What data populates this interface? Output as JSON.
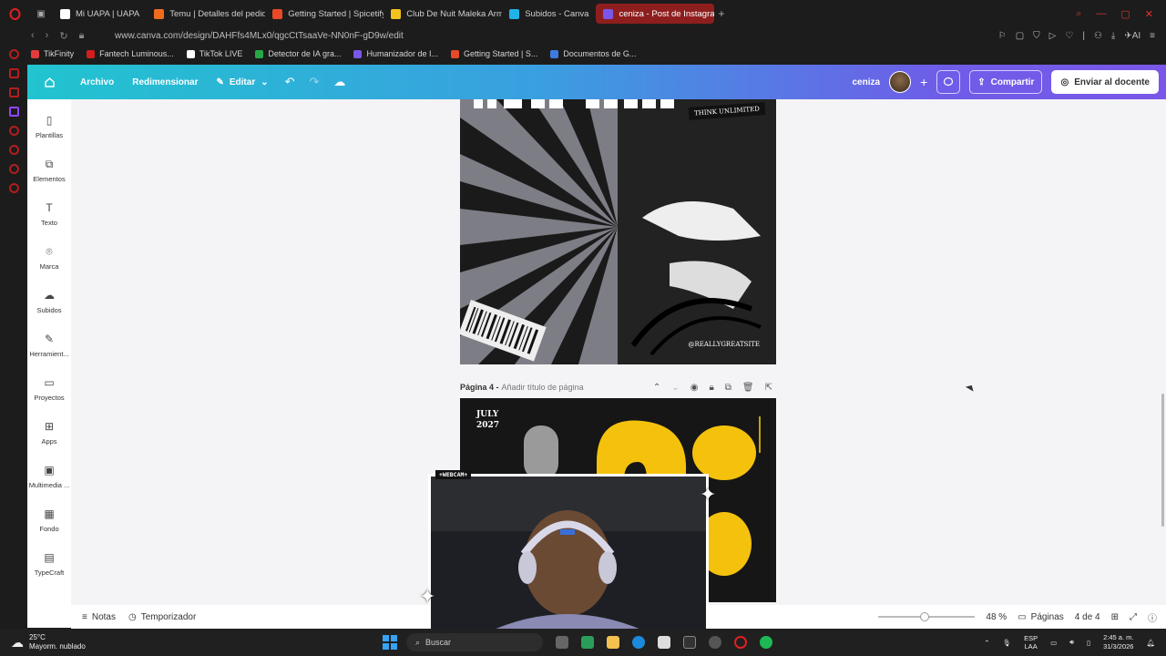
{
  "browser": {
    "tabs": [
      {
        "label": "Mi UAPA | UAPA",
        "color": "#ffffff"
      },
      {
        "label": "Temu | Detalles del pedido",
        "color": "#f26b1d"
      },
      {
        "label": "Getting Started | Spicetify",
        "color": "#e84a27"
      },
      {
        "label": "Club De Nuit Maleka Arme",
        "color": "#f3c320"
      },
      {
        "label": "Subidos - Canva",
        "color": "#20b3e8"
      },
      {
        "label": "ceniza - Post de Instagram",
        "color": "#7a57e8",
        "active": true
      }
    ],
    "url": "www.canva.com/design/DAHFfs4MLx0/qgcCtTsaaVe-NN0nF-gD9w/edit",
    "bookmarks": [
      {
        "label": "TikFinity",
        "color": "#e23b3b"
      },
      {
        "label": "Fantech Luminous...",
        "color": "#d21e1e"
      },
      {
        "label": "TikTok LIVE",
        "color": "#ffffff"
      },
      {
        "label": "Detector de IA gra...",
        "color": "#27a745"
      },
      {
        "label": "Humanizador de I...",
        "color": "#7a57e8"
      },
      {
        "label": "Getting Started | S...",
        "color": "#e84a27"
      },
      {
        "label": "Documentos de G...",
        "color": "#3f7ae0"
      }
    ]
  },
  "canva": {
    "menu": {
      "archivo": "Archivo",
      "redimensionar": "Redimensionar",
      "editar": "Editar"
    },
    "design_name": "ceniza",
    "share": "Compartir",
    "send": "Enviar al docente",
    "sidebar": [
      {
        "label": "Plantillas",
        "icon": "template-icon"
      },
      {
        "label": "Elementos",
        "icon": "elements-icon"
      },
      {
        "label": "Texto",
        "icon": "text-icon"
      },
      {
        "label": "Marca",
        "icon": "brand-icon"
      },
      {
        "label": "Subidos",
        "icon": "upload-icon"
      },
      {
        "label": "Herramient...",
        "icon": "tools-icon"
      },
      {
        "label": "Proyectos",
        "icon": "folder-icon"
      },
      {
        "label": "Apps",
        "icon": "apps-icon"
      },
      {
        "label": "Multimedia ...",
        "icon": "media-icon"
      },
      {
        "label": "Fondo",
        "icon": "background-icon"
      },
      {
        "label": "TypeCraft",
        "icon": "typecraft-icon"
      }
    ],
    "page3": {
      "badge": "THINK UNLIMITED",
      "handle": "@REALLYGREATSITE"
    },
    "page4_header": {
      "label": "Página 4 -",
      "placeholder": "Añadir título de página"
    },
    "page4": {
      "date": "JULY",
      "year": "2027"
    },
    "bottom": {
      "notes": "Notas",
      "timer": "Temporizador",
      "zoom": "48 %",
      "zoom_fraction": 0.48,
      "pages_label": "Páginas",
      "page_count": "4 de 4"
    }
  },
  "webcam_tag": "+WEBCAM+",
  "taskbar": {
    "temp": "25°C",
    "weather": "Mayorm. nublado",
    "search": "Buscar",
    "lang1": "ESP",
    "lang2": "LAA",
    "time": "2:45 a. m.",
    "date": "31/3/2026"
  }
}
